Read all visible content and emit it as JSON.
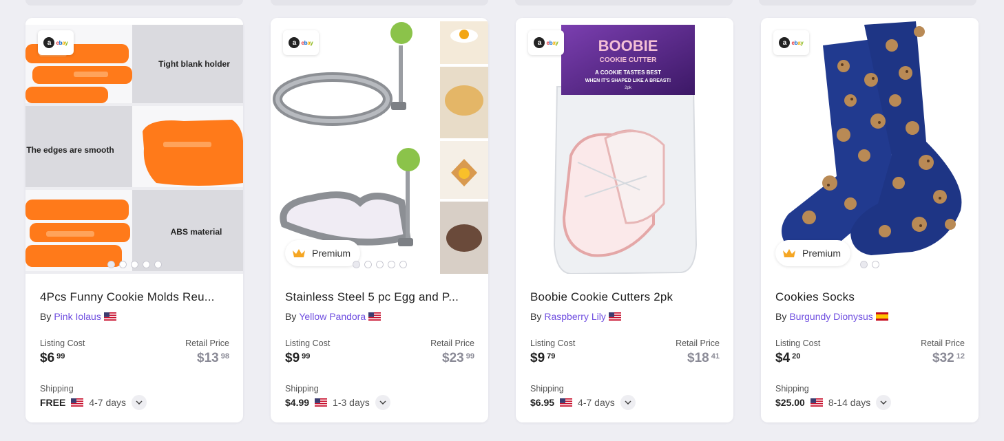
{
  "cards": [
    {
      "title": "4Pcs Funny Cookie Molds Reu...",
      "by_label": "By",
      "seller": "Pink Iolaus",
      "seller_flag": "us",
      "listing_label": "Listing Cost",
      "listing_dollars": "$6",
      "listing_cents": "99",
      "retail_label": "Retail Price",
      "retail_dollars": "$13",
      "retail_cents": "98",
      "shipping_label": "Shipping",
      "shipping_price": "FREE",
      "shipping_flag": "us",
      "shipping_days": "4-7 days",
      "premium": false,
      "image_texts": [
        "Tight blank holder",
        "The edges are smooth",
        "ABS material"
      ],
      "slide_dots": 5,
      "badge_letter": "a",
      "badge_brand": "ebay"
    },
    {
      "title": "Stainless Steel 5 pc Egg and P...",
      "by_label": "By",
      "seller": "Yellow Pandora",
      "seller_flag": "us",
      "listing_label": "Listing Cost",
      "listing_dollars": "$9",
      "listing_cents": "99",
      "retail_label": "Retail Price",
      "retail_dollars": "$23",
      "retail_cents": "99",
      "shipping_label": "Shipping",
      "shipping_price": "$4.99",
      "shipping_flag": "us",
      "shipping_days": "1-3 days",
      "premium": true,
      "premium_label": "Premium",
      "slide_dots": 5,
      "badge_letter": "a",
      "badge_brand": "ebay"
    },
    {
      "title": "Boobie Cookie Cutters 2pk",
      "by_label": "By",
      "seller": "Raspberry Lily",
      "seller_flag": "us",
      "listing_label": "Listing Cost",
      "listing_dollars": "$9",
      "listing_cents": "79",
      "retail_label": "Retail Price",
      "retail_dollars": "$18",
      "retail_cents": "41",
      "shipping_label": "Shipping",
      "shipping_price": "$6.95",
      "shipping_flag": "us",
      "shipping_days": "4-7 days",
      "premium": false,
      "package_texts": [
        "BOOBIE",
        "COOKIE CUTTER",
        "A COOKIE TASTES BEST",
        "WHEN IT'S SHAPED LIKE A BREAST!",
        "2pk"
      ],
      "slide_dots": 0,
      "badge_letter": "a",
      "badge_brand": "ebay"
    },
    {
      "title": "Cookies Socks",
      "by_label": "By",
      "seller": "Burgundy Dionysus",
      "seller_flag": "es",
      "listing_label": "Listing Cost",
      "listing_dollars": "$4",
      "listing_cents": "20",
      "retail_label": "Retail Price",
      "retail_dollars": "$32",
      "retail_cents": "12",
      "shipping_label": "Shipping",
      "shipping_price": "$25.00",
      "shipping_flag": "us",
      "shipping_days": "8-14 days",
      "premium": true,
      "premium_label": "Premium",
      "slide_dots": 2,
      "badge_letter": "a",
      "badge_brand": "ebay"
    }
  ],
  "icons": {
    "expand": "chevron-down-icon",
    "premium": "crown-icon",
    "marketplace": "ebay-logo-icon"
  },
  "colors": {
    "seller_link": "#6f4ee0",
    "premium_crown": "#f5a623",
    "retail_price": "#8a8a96"
  }
}
